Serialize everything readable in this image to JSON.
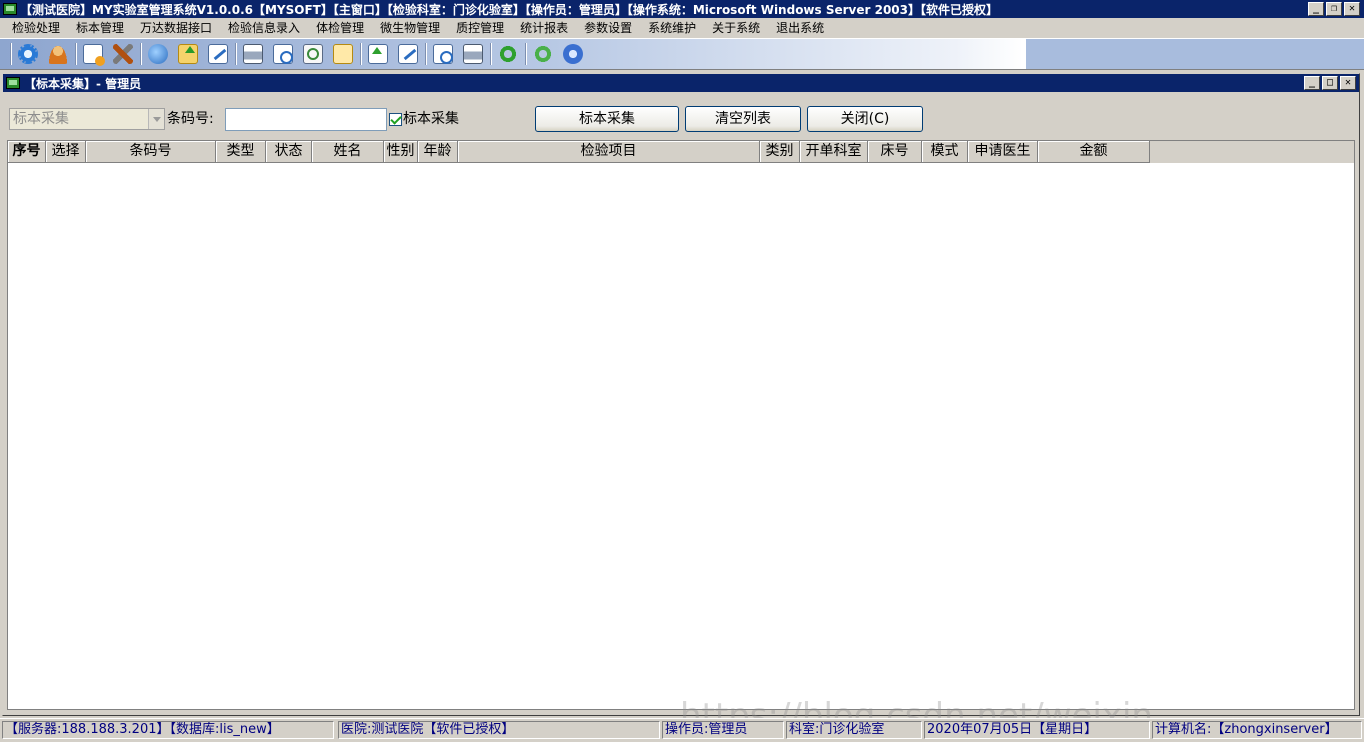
{
  "window": {
    "title": "【测试医院】MY实验室管理系统V1.0.0.6【MYSOFT】【主窗口】【检验科室：门诊化验室】【操作员：管理员】【操作系统：Microsoft Windows Server 2003】【软件已授权】",
    "btn_minimize": "_",
    "btn_restore": "❐",
    "btn_close": "✕"
  },
  "menu": {
    "items": [
      "检验处理",
      "标本管理",
      "万达数据接口",
      "检验信息录入",
      "体检管理",
      "微生物管理",
      "质控管理",
      "统计报表",
      "参数设置",
      "系统维护",
      "关于系统",
      "退出系统"
    ]
  },
  "toolbar": {
    "icons": [
      "gear-icon",
      "user-icon",
      "new-document-icon",
      "tools-icon",
      "globe-icon",
      "upload-icon",
      "edit-icon",
      "print-icon",
      "print-preview-icon",
      "search-icon",
      "copy-icon",
      "export-icon",
      "report-icon",
      "refresh-icon",
      "sync-icon",
      "power-icon"
    ]
  },
  "child": {
    "title": "【标本采集】- 管理员",
    "btn_minimize": "_",
    "btn_restore": "□",
    "btn_close": "✕"
  },
  "filter": {
    "mode_value": "标本采集",
    "barcode_label": "条码号:",
    "barcode_value": "",
    "collect_checkbox_label": "标本采集",
    "collect_checked": true,
    "btn_collect": "标本采集",
    "btn_clear": "清空列表",
    "btn_close": "关闭(C)"
  },
  "grid": {
    "columns": [
      "序号",
      "选择",
      "条码号",
      "类型",
      "状态",
      "姓名",
      "性别",
      "年龄",
      "检验项目",
      "类别",
      "开单科室",
      "床号",
      "模式",
      "申请医生",
      "金额"
    ],
    "rows": []
  },
  "status": {
    "server": "【服务器:188.188.3.201】【数据库:lis_new】",
    "hospital": "医院:测试医院【软件已授权】",
    "operator": "操作员:管理员",
    "dept": "科室:门诊化验室",
    "date": "2020年07月05日【星期日】",
    "computer": "计算机名:【zhongxinserver】"
  },
  "watermark": "https://blog.csdn.net/weixin_…"
}
